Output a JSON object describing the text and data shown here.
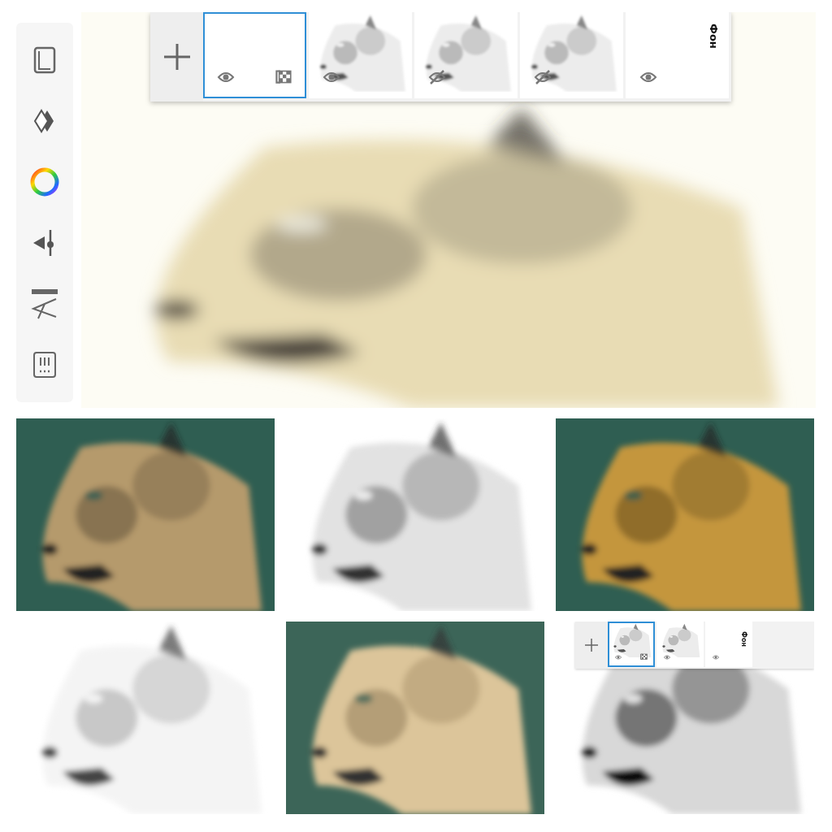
{
  "layers_panel": {
    "layers": [
      {
        "kind": "layer",
        "selected": true,
        "visible": true,
        "empty": true,
        "transparency_locked": true
      },
      {
        "kind": "layer",
        "selected": false,
        "visible": true,
        "empty": false,
        "transparency_locked": false
      },
      {
        "kind": "layer",
        "selected": false,
        "visible": false,
        "empty": false,
        "transparency_locked": false
      },
      {
        "kind": "layer",
        "selected": false,
        "visible": false,
        "empty": false,
        "transparency_locked": false
      },
      {
        "kind": "background",
        "selected": false,
        "visible": true,
        "label": "Фон"
      }
    ]
  },
  "mini_layers_panel": {
    "layers": [
      {
        "kind": "layer",
        "selected": true,
        "visible": true,
        "empty": false,
        "transparency_locked": true
      },
      {
        "kind": "layer",
        "selected": false,
        "visible": true,
        "empty": false,
        "transparency_locked": false
      },
      {
        "kind": "background",
        "selected": false,
        "visible": true,
        "label": "Фон"
      }
    ]
  }
}
